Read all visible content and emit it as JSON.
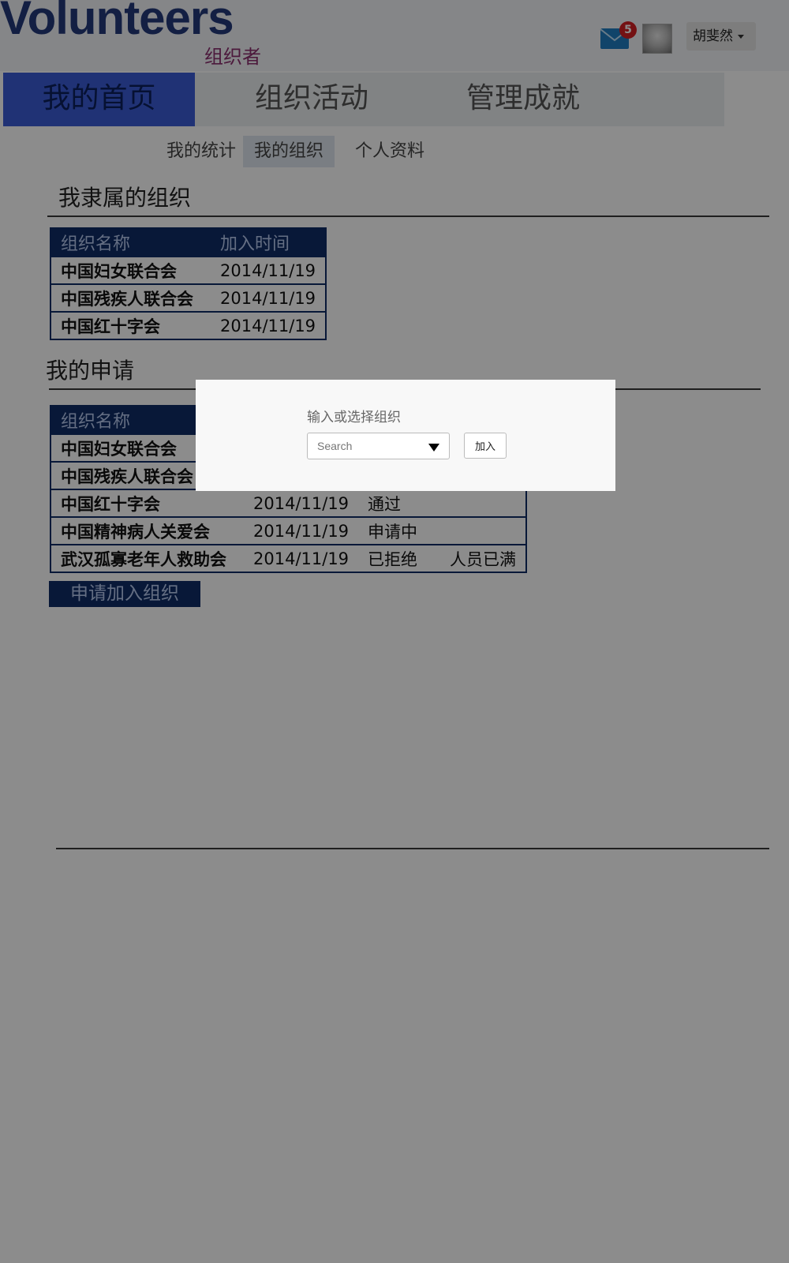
{
  "header": {
    "logo": "Volunteers",
    "role": "组织者",
    "mail_badge": "5",
    "user_name": "胡斐然",
    "icons": {
      "mail": "mail-icon",
      "avatar": "avatar",
      "caret": "chevron-down-icon"
    },
    "colors": {
      "badge": "#d32024",
      "logo": "#243a7a",
      "role": "#8a2e6e"
    }
  },
  "main_nav": {
    "items": [
      {
        "label": "我的首页",
        "active": true
      },
      {
        "label": "组织活动",
        "active": false
      },
      {
        "label": "管理成就",
        "active": false
      }
    ]
  },
  "sub_nav": {
    "items": [
      {
        "label": "我的统计",
        "active": false
      },
      {
        "label": "我的组织",
        "active": true
      },
      {
        "label": "个人资料",
        "active": false
      }
    ]
  },
  "affiliated": {
    "title": "我隶属的组织",
    "columns": [
      "组织名称",
      "加入时间"
    ],
    "rows": [
      {
        "name": "中国妇女联合会",
        "date": "2014/11/19"
      },
      {
        "name": "中国残疾人联合会",
        "date": "2014/11/19"
      },
      {
        "name": "中国红十字会",
        "date": "2014/11/19"
      }
    ]
  },
  "applications": {
    "title": "我的申请",
    "columns": [
      "组织名称"
    ],
    "rows": [
      {
        "name": "中国妇女联合会",
        "date": "",
        "status": "",
        "note": ""
      },
      {
        "name": "中国残疾人联合会",
        "date": "",
        "status": "",
        "note": ""
      },
      {
        "name": "中国红十字会",
        "date": "2014/11/19",
        "status": "通过",
        "note": ""
      },
      {
        "name": "中国精神病人关爱会",
        "date": "2014/11/19",
        "status": "申请中",
        "note": ""
      },
      {
        "name": "武汉孤寡老年人救助会",
        "date": "2014/11/19",
        "status": "已拒绝",
        "note": "人员已满"
      }
    ],
    "apply_button": "申请加入组织"
  },
  "modal": {
    "label": "输入或选择组织",
    "search_placeholder": "Search",
    "join_button": "加入"
  },
  "colors": {
    "table_header": "#0f2d66",
    "nav_active": "#3b5bd6",
    "overlay": "rgba(0,0,0,0.45)"
  }
}
